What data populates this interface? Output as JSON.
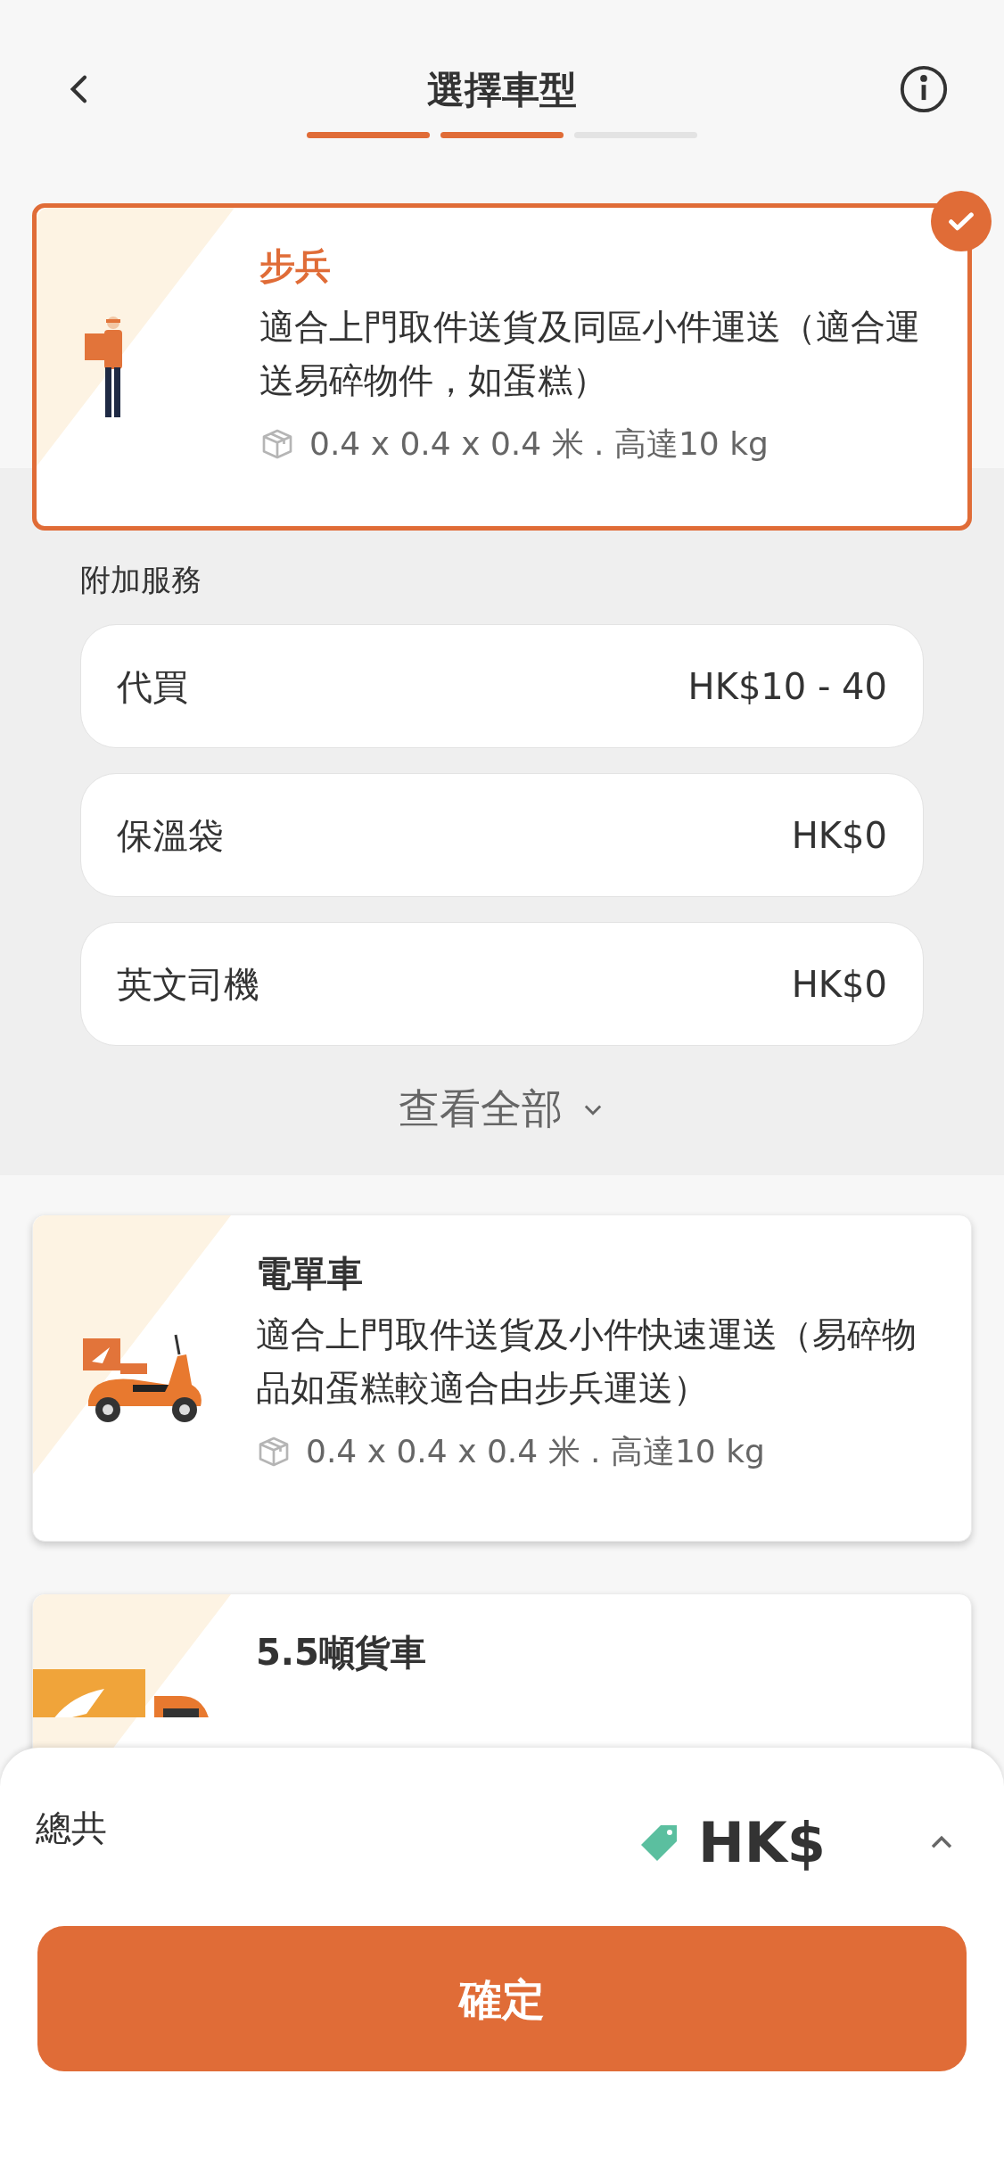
{
  "header": {
    "title": "選擇車型",
    "steps": [
      {
        "completed": true
      },
      {
        "completed": true
      },
      {
        "completed": false
      }
    ]
  },
  "vehicles": [
    {
      "kind": "walker",
      "name": "步兵",
      "selected": true,
      "description": "適合上門取件送貨及同區小件運送（適合運送易碎物件，如蛋糕）",
      "spec": "0.4 x 0.4 x 0.4 米 . 高達10 kg",
      "add_ons": {
        "title": "附加服務",
        "items": [
          {
            "name": "代買",
            "price": "HK$10 - 40"
          },
          {
            "name": "保溫袋",
            "price": "HK$0"
          },
          {
            "name": "英文司機",
            "price": "HK$0"
          }
        ],
        "view_all": "查看全部"
      }
    },
    {
      "kind": "scooter",
      "name": "電單車",
      "selected": false,
      "description": "適合上門取件送貨及小件快速運送（易碎物品如蛋糕較適合由步兵運送）",
      "spec": "0.4 x 0.4 x 0.4 米 . 高達10 kg"
    },
    {
      "kind": "truck",
      "name": "5.5噸貨車",
      "selected": false
    }
  ],
  "summary": {
    "label": "總共",
    "price": "HK$",
    "expanded": false
  },
  "confirm_button": "確定"
}
